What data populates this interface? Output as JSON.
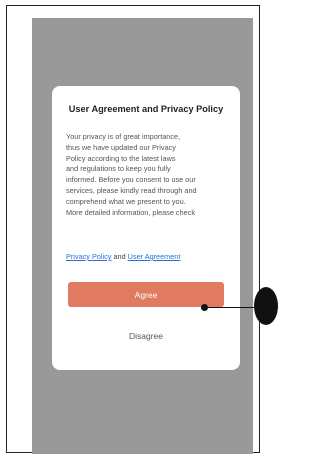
{
  "dialog": {
    "title": "User Agreement and Privacy Policy",
    "body_lines": [
      "Your privacy is of great importance,",
      "thus we have updated our Privacy",
      "Policy according to the latest laws",
      "and regulations to keep you fully",
      "informed. Before you consent to use our",
      "services, please kindly read through and",
      "comprehend what we present to you.",
      "More detailed information, please check"
    ],
    "privacy_link": "Privacy Policy",
    "and_text": "and",
    "agreement_link": "User Agreement",
    "agree_label": "Agree",
    "disagree_label": "Disagree"
  },
  "colors": {
    "overlay": "#999999",
    "accent": "#e07a60",
    "link": "#2b6fd6"
  }
}
